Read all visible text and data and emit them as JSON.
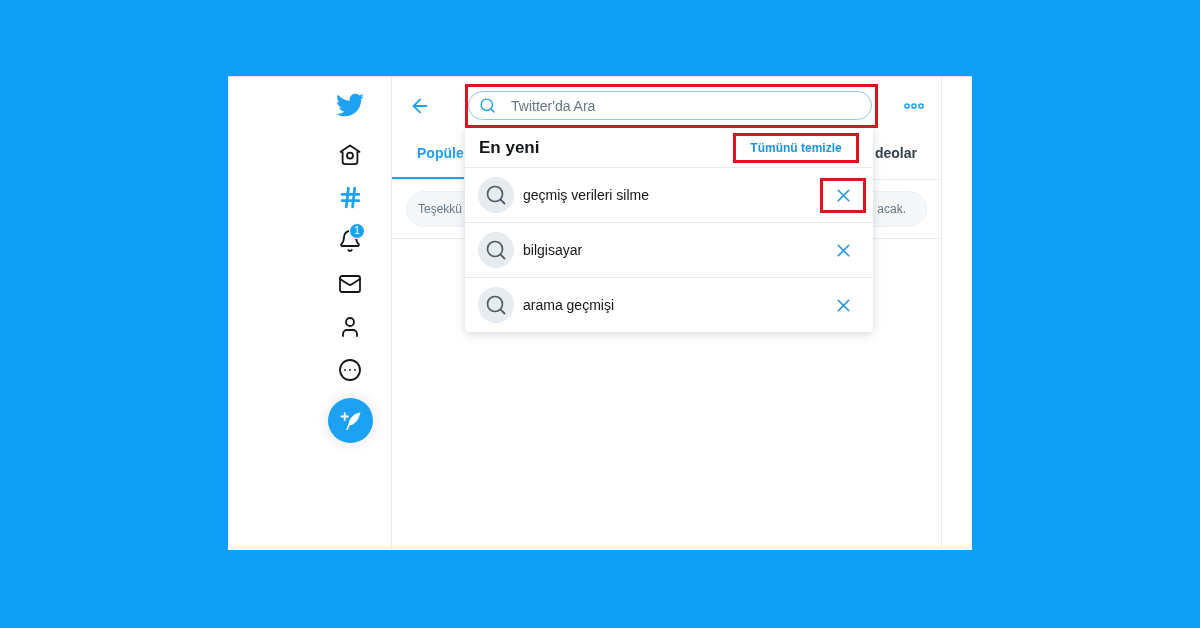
{
  "sidebar": {
    "nav": [
      {
        "kind": "home",
        "selected": false
      },
      {
        "kind": "explore",
        "selected": true
      },
      {
        "kind": "notifications",
        "selected": false,
        "badge": "1"
      },
      {
        "kind": "messages",
        "selected": false
      },
      {
        "kind": "profile",
        "selected": false
      },
      {
        "kind": "more",
        "selected": false
      }
    ]
  },
  "search": {
    "placeholder": "Twitter'da Ara",
    "highlighted": true
  },
  "tabs": [
    {
      "label": "Popüle",
      "selected": true
    },
    {
      "label": "deolar",
      "selected": false
    }
  ],
  "notice": {
    "left_text": "Teşekkü",
    "right_text": "acak."
  },
  "recent_searches": {
    "title": "En yeni",
    "clear_all": {
      "label": "Tümünü temizle",
      "highlighted": true
    },
    "items": [
      {
        "query": "geçmiş verileri silme",
        "remove_highlighted": true
      },
      {
        "query": "bilgisayar",
        "remove_highlighted": false
      },
      {
        "query": "arama geçmişi",
        "remove_highlighted": false
      }
    ]
  }
}
